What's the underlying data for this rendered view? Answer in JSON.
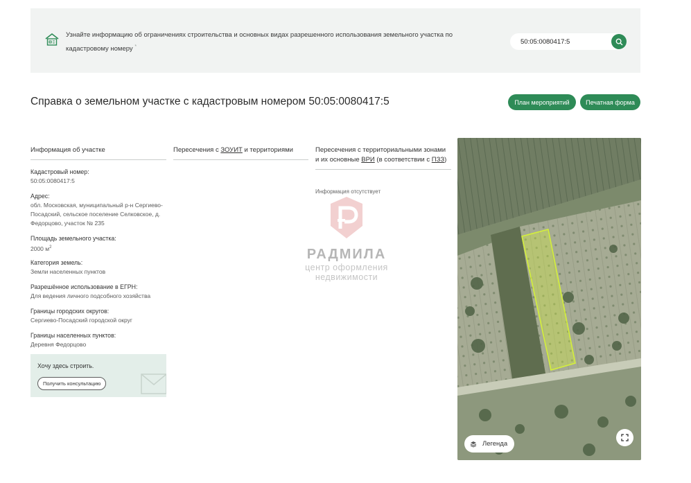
{
  "banner": {
    "text": "Узнайте информацию об ограничениях строительства и основных видах разрешенного использования земельного участка по кадастровому номеру",
    "asterisk": "*",
    "search_value": "50:05:0080417:5",
    "search_icon": "search-icon"
  },
  "header": {
    "title": "Справка о земельном участке с кадастровым номером 50:05:0080417:5",
    "plan_button": "План мероприятий",
    "print_button": "Печатная форма"
  },
  "columns": {
    "info_heading": "Информация об участке",
    "intersections_prefix": "Пересечения с ",
    "intersections_link": "ЗОУИТ",
    "intersections_suffix": " и территориями",
    "zones_prefix": "Пересечения с территориальными зонами и их основные ",
    "zones_link1": "ВРИ",
    "zones_mid": " (в соответствии с ",
    "zones_link2": "ПЗЗ",
    "zones_suffix": ")",
    "zones_absent": "Информация отсутствует"
  },
  "info": [
    {
      "label": "Кадастровый номер:",
      "value": "50:05:0080417:5"
    },
    {
      "label": "Адрес:",
      "value": "обл. Московская, муниципальный р-н Сергиево-Посадский, сельское поселение Селковское, д. Федорцово, участок № 235"
    },
    {
      "label": "Площадь земельного участка:",
      "value": "2000 м",
      "sup": "2"
    },
    {
      "label": "Категория земель:",
      "value": "Земли населенных пунктов"
    },
    {
      "label": "Разрешённое использование в ЕГРН:",
      "value": "Для ведения личного подсобного хозяйства"
    },
    {
      "label": "Границы городских округов:",
      "value": "Сергиево-Посадский городской округ"
    },
    {
      "label": "Границы населенных пунктов:",
      "value": "Деревня Федорцово"
    }
  ],
  "consult": {
    "title": "Хочу здесь строить.",
    "button": "Получить консультацию"
  },
  "watermark": {
    "name": "РАДМИЛА",
    "line1": "центр оформления",
    "line2": "недвижимости"
  },
  "map": {
    "legend_label": "Легенда",
    "parcel_color": "#d4f03a"
  },
  "colors": {
    "accent": "#2e8b57",
    "banner_bg": "#f1f3f2",
    "consult_bg": "#e3eee9"
  }
}
